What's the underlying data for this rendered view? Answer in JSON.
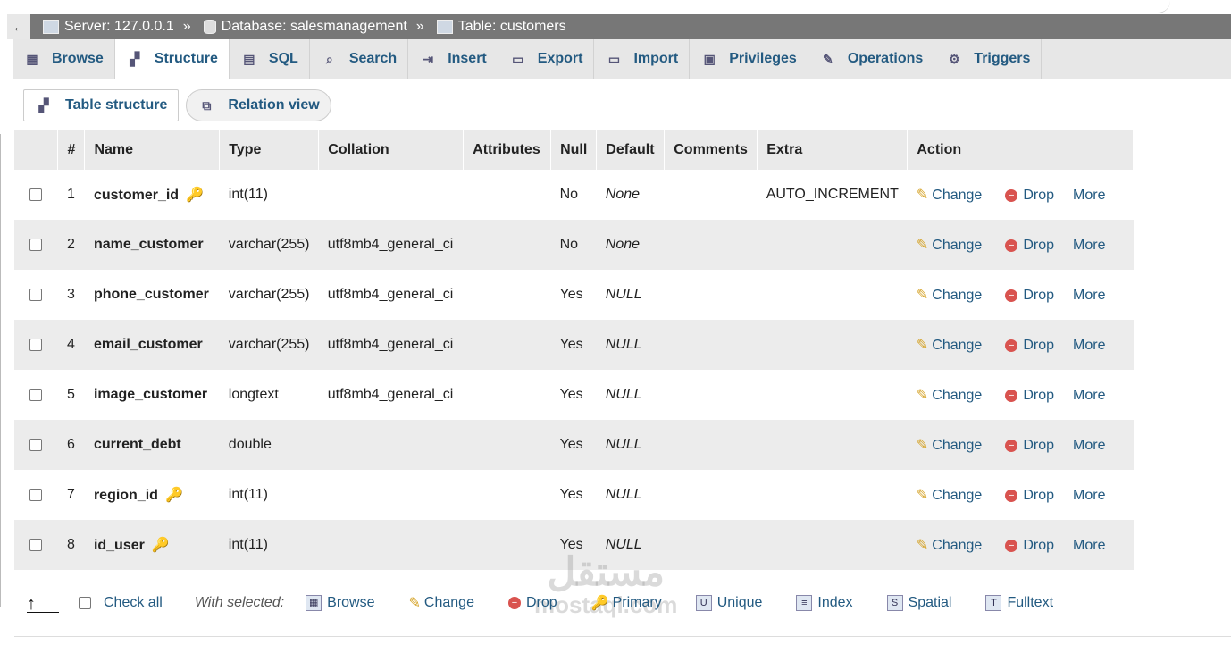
{
  "breadcrumb": {
    "back": "←",
    "server": "Server: 127.0.0.1",
    "database": "Database: salesmanagement",
    "table": "Table: customers",
    "sep": "»"
  },
  "tabs": [
    {
      "label": "Browse",
      "icon": "browse-icon"
    },
    {
      "label": "Structure",
      "icon": "structure-icon",
      "active": true
    },
    {
      "label": "SQL",
      "icon": "sql-icon"
    },
    {
      "label": "Search",
      "icon": "search-icon"
    },
    {
      "label": "Insert",
      "icon": "insert-icon"
    },
    {
      "label": "Export",
      "icon": "export-icon"
    },
    {
      "label": "Import",
      "icon": "import-icon"
    },
    {
      "label": "Privileges",
      "icon": "privileges-icon"
    },
    {
      "label": "Operations",
      "icon": "wrench-icon"
    },
    {
      "label": "Triggers",
      "icon": "triggers-icon"
    }
  ],
  "subtabs": {
    "table_structure": "Table structure",
    "relation_view": "Relation view"
  },
  "columns": [
    "#",
    "Name",
    "Type",
    "Collation",
    "Attributes",
    "Null",
    "Default",
    "Comments",
    "Extra",
    "Action"
  ],
  "rows": [
    {
      "num": "1",
      "name": "customer_id",
      "key": "primary",
      "type": "int(11)",
      "collation": "",
      "null": "No",
      "default": "None",
      "extra": "AUTO_INCREMENT"
    },
    {
      "num": "2",
      "name": "name_customer",
      "key": "",
      "type": "varchar(255)",
      "collation": "utf8mb4_general_ci",
      "null": "No",
      "default": "None",
      "extra": ""
    },
    {
      "num": "3",
      "name": "phone_customer",
      "key": "",
      "type": "varchar(255)",
      "collation": "utf8mb4_general_ci",
      "null": "Yes",
      "default": "NULL",
      "extra": ""
    },
    {
      "num": "4",
      "name": "email_customer",
      "key": "",
      "type": "varchar(255)",
      "collation": "utf8mb4_general_ci",
      "null": "Yes",
      "default": "NULL",
      "extra": ""
    },
    {
      "num": "5",
      "name": "image_customer",
      "key": "",
      "type": "longtext",
      "collation": "utf8mb4_general_ci",
      "null": "Yes",
      "default": "NULL",
      "extra": ""
    },
    {
      "num": "6",
      "name": "current_debt",
      "key": "",
      "type": "double",
      "collation": "",
      "null": "Yes",
      "default": "NULL",
      "extra": ""
    },
    {
      "num": "7",
      "name": "region_id",
      "key": "index",
      "type": "int(11)",
      "collation": "",
      "null": "Yes",
      "default": "NULL",
      "extra": ""
    },
    {
      "num": "8",
      "name": "id_user",
      "key": "index",
      "type": "int(11)",
      "collation": "",
      "null": "Yes",
      "default": "NULL",
      "extra": ""
    }
  ],
  "actions": {
    "change": "Change",
    "drop": "Drop",
    "more": "More"
  },
  "bottom": {
    "check_all": "Check all",
    "with_selected": "With selected:",
    "browse": "Browse",
    "change": "Change",
    "drop": "Drop",
    "primary": "Primary",
    "unique": "Unique",
    "index": "Index",
    "spatial": "Spatial",
    "fulltext": "Fulltext"
  },
  "watermark": {
    "ar": "مستقل",
    "en": "mostaql.com"
  }
}
